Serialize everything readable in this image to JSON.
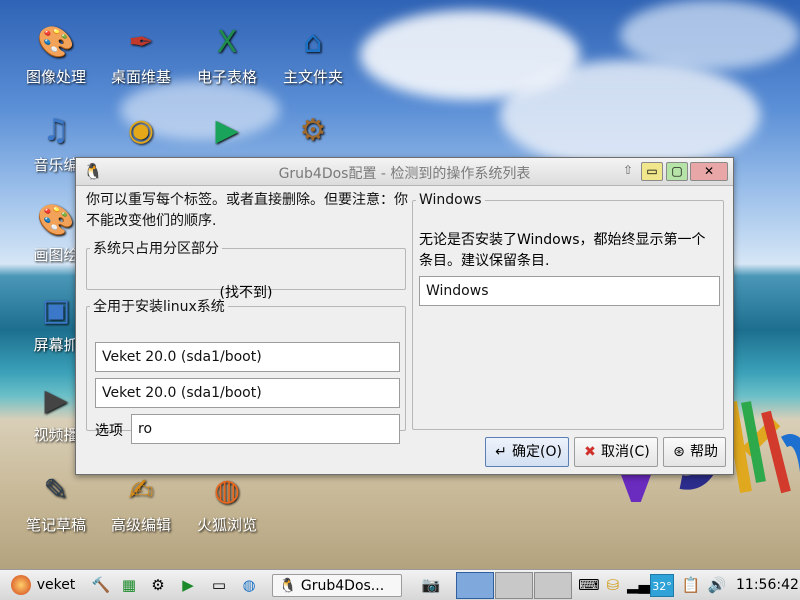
{
  "desktop": {
    "icons": [
      {
        "name": "desktop-icon-image-processing",
        "label": "图像处理",
        "glyph": "🎨",
        "color": "#3d3d3d"
      },
      {
        "name": "desktop-icon-desktop-wiki",
        "label": "桌面维基",
        "glyph": "✒",
        "color": "#c0392b"
      },
      {
        "name": "desktop-icon-spreadsheet",
        "label": "电子表格",
        "glyph": "X",
        "color": "#1f8b4c"
      },
      {
        "name": "desktop-icon-home-folder",
        "label": "主文件夹",
        "glyph": "⌂",
        "color": "#1b72c7"
      },
      {
        "name": "desktop-icon-music-editor",
        "label": "音乐编",
        "glyph": "♫",
        "color": "#3b78c9"
      },
      {
        "name": "desktop-icon-chrome",
        "label": "",
        "glyph": "◉",
        "color": "#e5a818"
      },
      {
        "name": "desktop-icon-media-player",
        "label": "",
        "glyph": "▶",
        "color": "#1aa35a"
      },
      {
        "name": "desktop-icon-package",
        "label": "",
        "glyph": "⚙",
        "color": "#a06a2c"
      },
      {
        "name": "desktop-icon-drawing",
        "label": "画图绘",
        "glyph": "🎨",
        "color": "#c99a3a"
      },
      {
        "name": "desktop-icon-screenshot",
        "label": "屏幕抓",
        "glyph": "▣",
        "color": "#3b78c9"
      },
      {
        "name": "desktop-icon-video",
        "label": "视频播",
        "glyph": "▶",
        "color": "#444"
      },
      {
        "name": "desktop-icon-notes",
        "label": "笔记草稿",
        "glyph": "✎",
        "color": "#2c3e50"
      },
      {
        "name": "desktop-icon-advanced-editor",
        "label": "高级编辑",
        "glyph": "✍",
        "color": "#d68a18"
      },
      {
        "name": "desktop-icon-firefox",
        "label": "火狐浏览",
        "glyph": "◍",
        "color": "#e8681f"
      }
    ]
  },
  "window": {
    "title": "Grub4Dos配置 - 检测到的操作系统列表",
    "pin_glyph": "⇧",
    "min_glyph": "▭",
    "max_glyph": "▢",
    "close_glyph": "✕",
    "intro": "你可以重写每个标签。或者直接删除。但要注意：你不能改变他们的顺序.",
    "system_group": {
      "legend": "系统只占用分区部分",
      "value": "(找不到)"
    },
    "linux_group": {
      "legend": "全用于安装linux系统",
      "entry1": "Veket 20.0 (sda1/boot)",
      "entry2": "Veket 20.0 (sda1/boot)",
      "options_label": "选项",
      "options_value": "ro"
    },
    "windows_group": {
      "legend": "Windows",
      "description": "无论是否安装了Windows，都始终显示第一个条目。建议保留条目.",
      "entry": "Windows"
    },
    "buttons": {
      "ok": "确定(O)",
      "cancel": "取消(C)",
      "help": "帮助"
    }
  },
  "taskbar": {
    "start_label": "veket",
    "task_label": "Grub4Dos...",
    "temperature": "32°",
    "clock": "11:56:42"
  }
}
